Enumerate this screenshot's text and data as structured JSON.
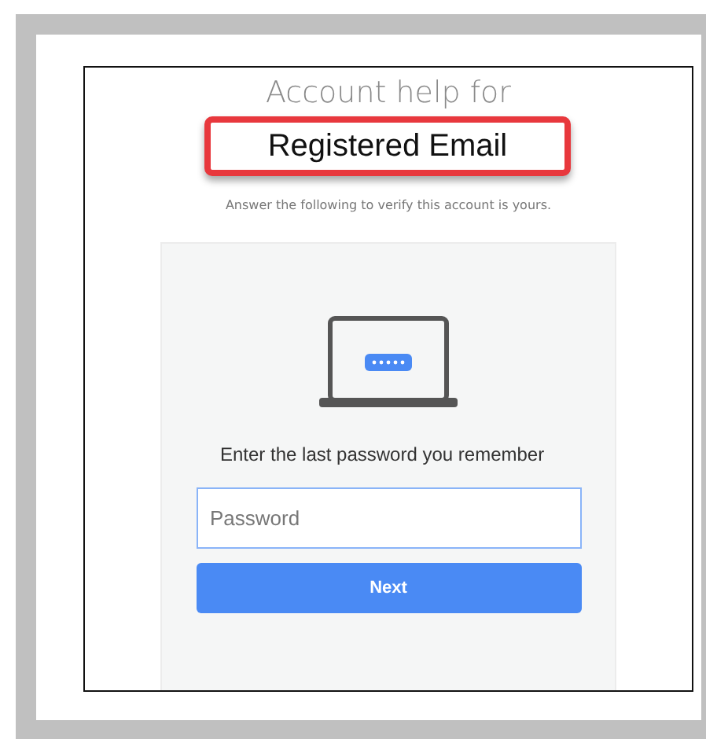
{
  "heading": "Account help for",
  "account": "Registered Email",
  "subtitle": "Answer the following to verify this account is yours.",
  "card": {
    "prompt": "Enter the last password you remember",
    "password_field": {
      "placeholder": "Password"
    },
    "next_button": {
      "label": "Next"
    }
  }
}
